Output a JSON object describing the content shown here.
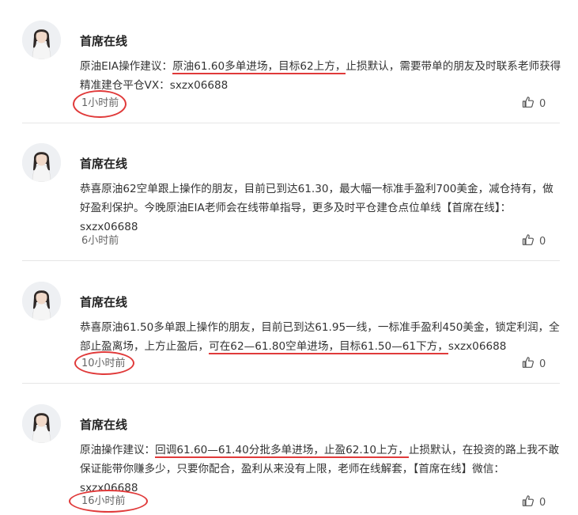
{
  "colors": {
    "accent": "#e03a3a",
    "divider": "#e6e6e6",
    "text": "#333333"
  },
  "posts": [
    {
      "author": "首席在线",
      "text": {
        "a": "原油EIA操作建议：",
        "b": "原油61.60多单进场，目标62上方，",
        "c": "止损默认，需要带单的朋友及时联系老师获得精准建仓平仓VX：sxzx06688"
      },
      "time": "1小时前",
      "likes": "0"
    },
    {
      "author": "首席在线",
      "text": {
        "a": "恭喜原油62空单跟上操作的朋友，目前已到达61.30，最大幅一标准手盈利700美金，减仓持有，做好盈利保护。今晚原油EIA老师会在线带单指导，更多及时平仓建仓点位单线【首席在线】：sxzx06688"
      },
      "time": "6小时前",
      "likes": "0"
    },
    {
      "author": "首席在线",
      "text": {
        "a": "恭喜原油61.50多单跟上操作的朋友，目前已到达61.95一线，一标准手盈利450美金，锁定利润，全部止盈离场，上方止盈后，",
        "b": "可在62—61.80空单进场，目标61.50—61下方，",
        "c": "sxzx06688"
      },
      "time": "10小时前",
      "likes": "0"
    },
    {
      "author": "首席在线",
      "text": {
        "a": "原油操作建议：",
        "b": "回调61.60—61.40分批多单进场，止盈62.10上方，",
        "c": "止损默认，在投资的路上我不敢保证能带你赚多少，只要你配合，盈利从来没有上限，老师在线解套，【首席在线】微信：sxzx06688"
      },
      "time": "16小时前",
      "likes": "0"
    }
  ]
}
